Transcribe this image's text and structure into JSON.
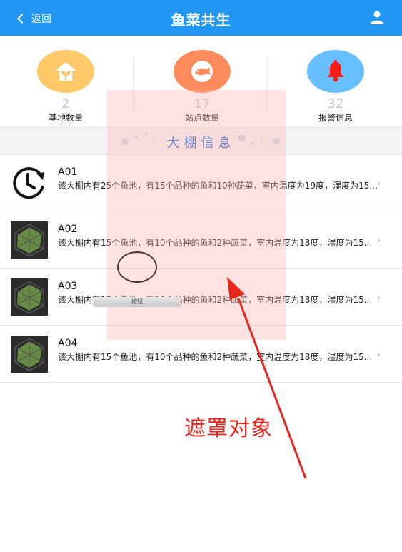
{
  "header": {
    "back_label": "返回",
    "title": "鱼菜共生",
    "icons": {
      "back": "chevron-left-icon",
      "user": "user-icon"
    }
  },
  "stats": [
    {
      "count": "2",
      "label": "基地数量",
      "icon": "house-sprout-icon",
      "color": "#ffc868"
    },
    {
      "count": "17",
      "label": "站点数量",
      "icon": "fish-icon",
      "color": "#ff8a5c"
    },
    {
      "count": "32",
      "label": "报警信息",
      "icon": "bell-icon",
      "color": "#68bfff"
    }
  ],
  "section": {
    "title": "大棚信息"
  },
  "greenhouses": [
    {
      "name": "A01",
      "desc": "该大棚内有25个鱼池，有15个品种的鱼和10种蔬菜，室内温度为19度，湿度为15...",
      "thumb": "clock-icon"
    },
    {
      "name": "A02",
      "desc": "该大棚内有15个鱼池，有10个品种的鱼和2种蔬菜，室内温度为18度，湿度为15...",
      "thumb": "radar-chart-icon"
    },
    {
      "name": "A03",
      "desc": "该大棚内有15个鱼池，有10个品种的鱼和2种蔬菜，室内温度为18度，湿度为15...",
      "thumb": "radar-chart-icon"
    },
    {
      "name": "A04",
      "desc": "该大棚内有15个鱼池，有10个品种的鱼和2种蔬菜，室内温度为18度，湿度为15...",
      "thumb": "radar-chart-icon"
    }
  ],
  "overlay": {
    "button_label": "按钮",
    "annotation": "遮罩对象",
    "mask_color": "#ffb0b0",
    "arrow_color": "#e8261c"
  }
}
